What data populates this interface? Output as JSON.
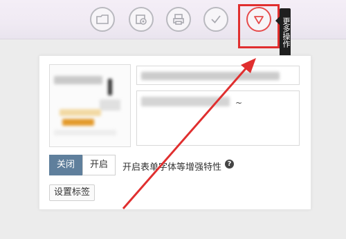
{
  "toolbar": {
    "buttons": [
      {
        "icon": "folder-icon"
      },
      {
        "icon": "camera-folder-icon"
      },
      {
        "icon": "printer-icon"
      },
      {
        "icon": "check-icon"
      },
      {
        "icon": "triangle-down-icon"
      }
    ],
    "tooltip_label": "更多操作"
  },
  "form": {
    "title_value": "",
    "description_tail": "~",
    "toggle": {
      "off_label": "关闭",
      "on_label": "开启",
      "selected": "off"
    },
    "feature_label": "开启表单字体等增强特性",
    "help_glyph": "?",
    "tag_button_label": "设置标签"
  },
  "colors": {
    "toolbar_bg": "#f0eaf3",
    "active_button": "#e64b4b",
    "toggle_selected": "#5f7f9c",
    "annotation_red": "#e02f2f"
  }
}
